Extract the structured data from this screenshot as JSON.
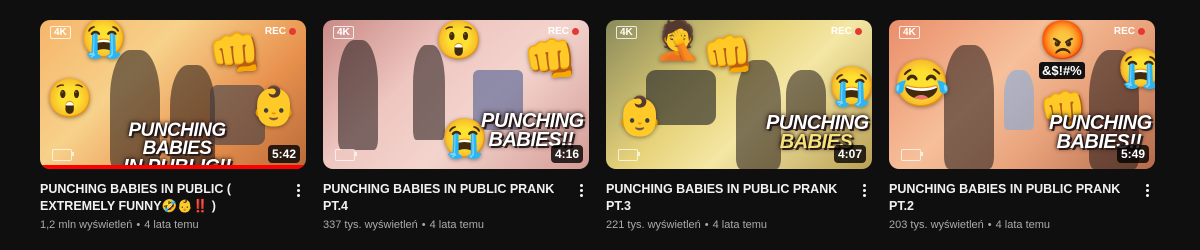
{
  "videos": [
    {
      "title": "PUNCHING BABIES IN PUBLIC ( EXTREMELY FUNNY🤣👶‼️ )",
      "views": "1,2 mln wyświetleń",
      "age": "4 lata temu",
      "duration": "5:42",
      "thumb_text_line1": "PUNCHING BABIES",
      "thumb_text_line2": "IN PUBLIC!!",
      "badge_4k": "4K",
      "badge_rec": "REC",
      "watched_progress": 1.0
    },
    {
      "title": "PUNCHING BABIES IN PUBLIC PRANK PT.4",
      "views": "337 tys. wyświetleń",
      "age": "4 lata temu",
      "duration": "4:16",
      "thumb_text_line1": "PUNCHING",
      "thumb_text_line2": "BABIES!!",
      "badge_4k": "4K",
      "badge_rec": "REC"
    },
    {
      "title": "PUNCHING BABIES IN PUBLIC PRANK PT.3",
      "views": "221 tys. wyświetleń",
      "age": "4 lata temu",
      "duration": "4:07",
      "thumb_text_line1": "PUNCHING",
      "thumb_text_line2": "BABIES",
      "badge_4k": "4K",
      "badge_rec": "REC"
    },
    {
      "title": "PUNCHING BABIES IN PUBLIC PRANK PT.2",
      "views": "203 tys. wyświetleń",
      "age": "4 lata temu",
      "duration": "5:49",
      "thumb_text_line1": "PUNCHING",
      "thumb_text_line2": "BABIES!!",
      "thumb_text_extra": "&$!#%",
      "badge_4k": "4K",
      "badge_rec": "REC"
    }
  ],
  "separator": "•",
  "icons": {
    "more_actions": "kebab-menu-icon"
  }
}
